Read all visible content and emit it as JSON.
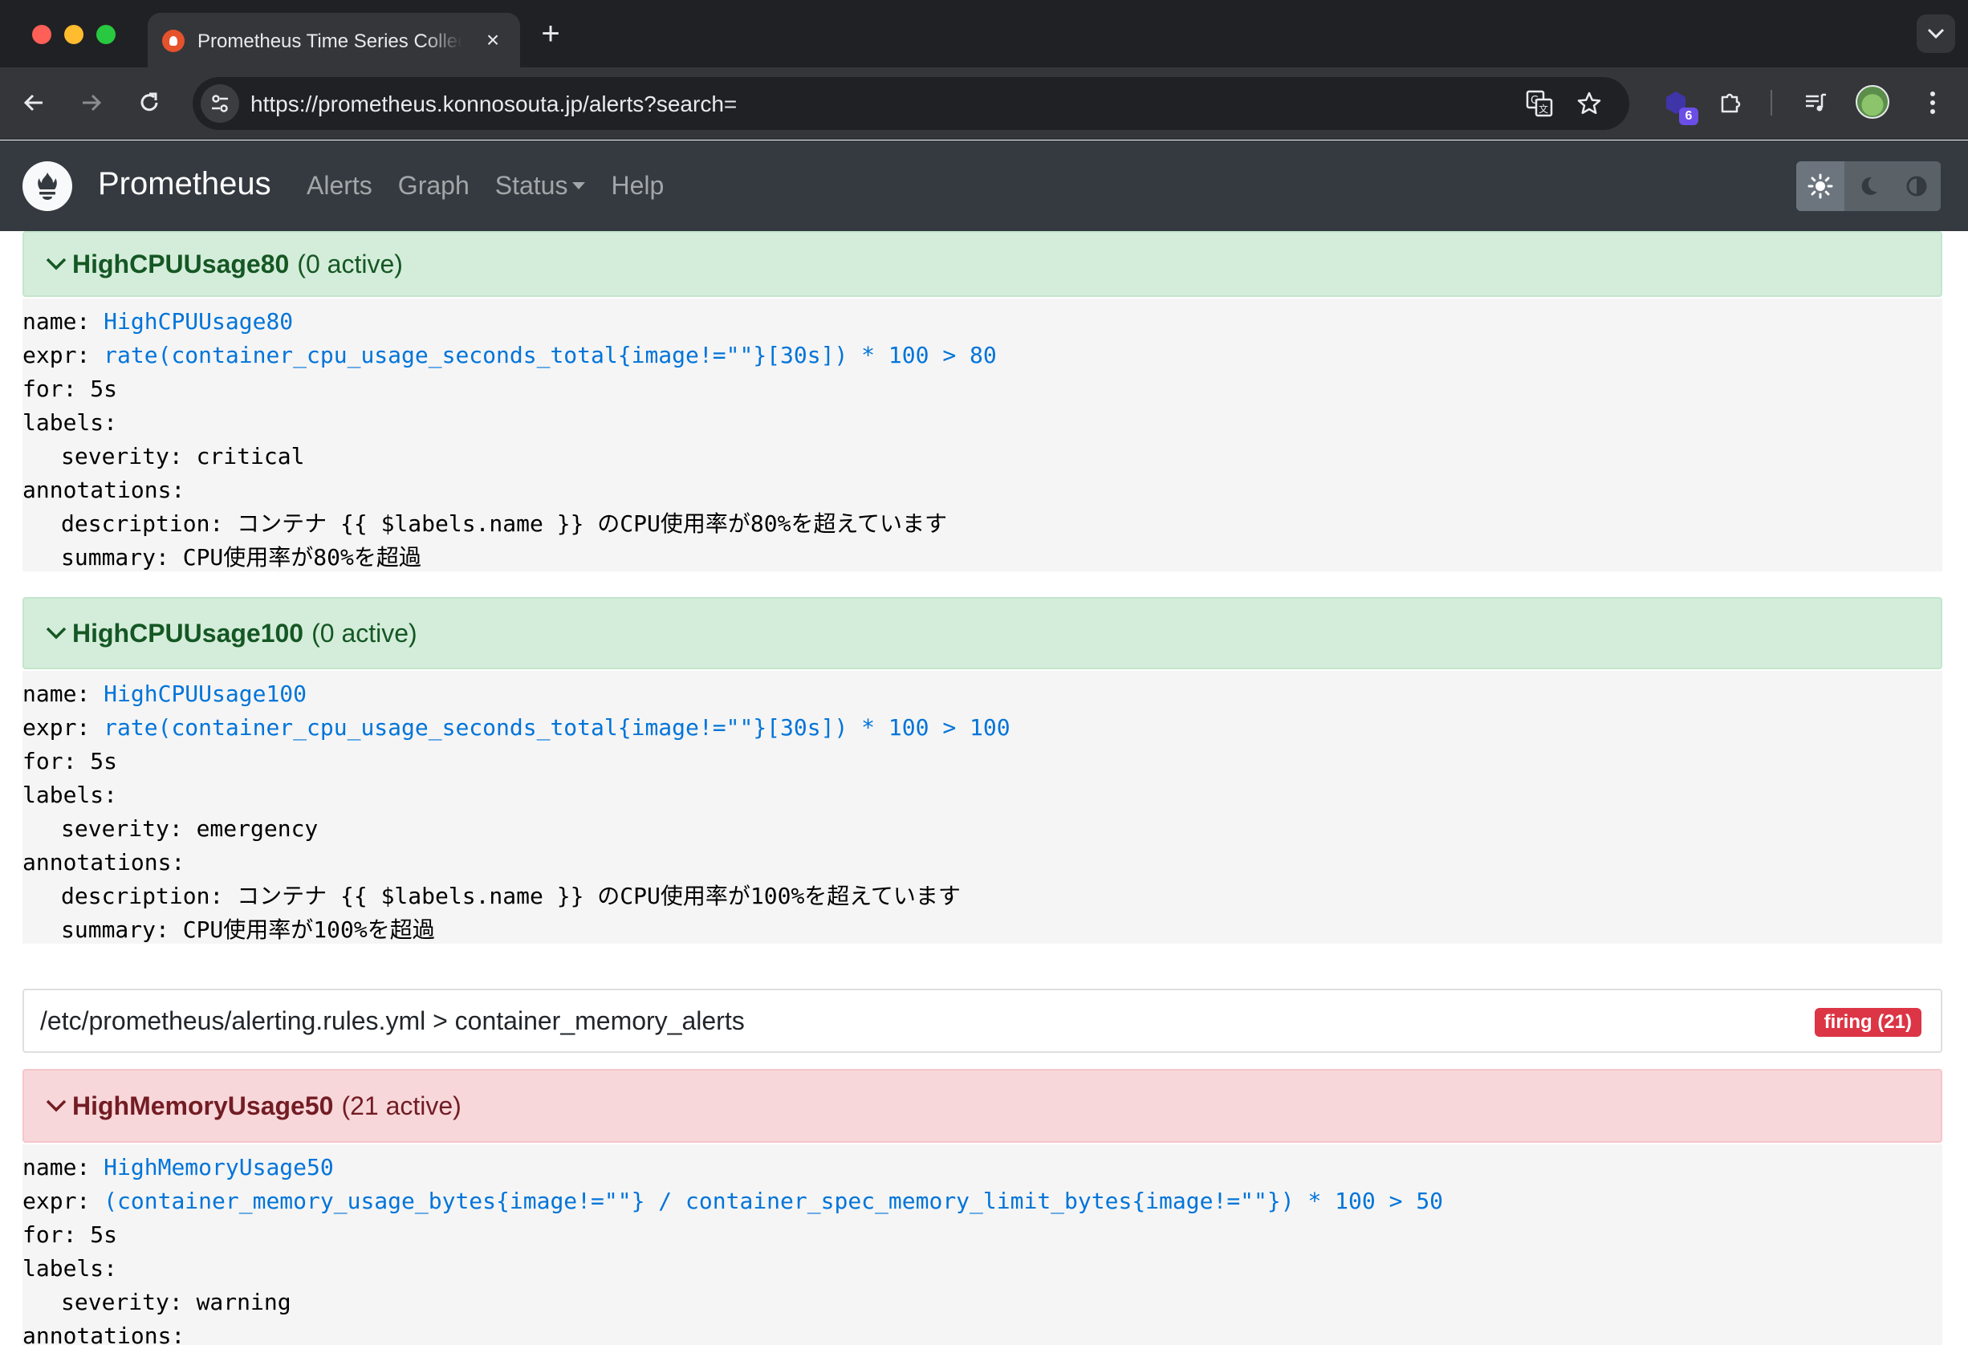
{
  "browser": {
    "tab_title": "Prometheus Time Series Collection and Processing Server",
    "url": "https://prometheus.konnosouta.jp/alerts?search=",
    "extension_badge": "6"
  },
  "app": {
    "brand": "Prometheus",
    "nav": [
      "Alerts",
      "Graph",
      "Status",
      "Help"
    ]
  },
  "rules": [
    {
      "name": "HighCPUUsage80",
      "count": "(0 active)",
      "state": "inactive",
      "lines": [
        {
          "k": "name: ",
          "v": "HighCPUUsage80"
        },
        {
          "k": "expr: ",
          "v": "rate(container_cpu_usage_seconds_total{image!=\"\"}[30s]) * 100 > 80"
        },
        {
          "k": "for: 5s",
          "v": ""
        },
        {
          "k": "labels:",
          "v": ""
        },
        {
          "k": "severity: critical",
          "v": "",
          "indent": true
        },
        {
          "k": "annotations:",
          "v": ""
        },
        {
          "k": "description: コンテナ {{ $labels.name }} のCPU使用率が80%を超えています",
          "v": "",
          "indent": true
        },
        {
          "k": "summary: CPU使用率が80%を超過",
          "v": "",
          "indent": true
        }
      ]
    },
    {
      "name": "HighCPUUsage100",
      "count": "(0 active)",
      "state": "inactive",
      "lines": [
        {
          "k": "name: ",
          "v": "HighCPUUsage100"
        },
        {
          "k": "expr: ",
          "v": "rate(container_cpu_usage_seconds_total{image!=\"\"}[30s]) * 100 > 100"
        },
        {
          "k": "for: 5s",
          "v": ""
        },
        {
          "k": "labels:",
          "v": ""
        },
        {
          "k": "severity: emergency",
          "v": "",
          "indent": true
        },
        {
          "k": "annotations:",
          "v": ""
        },
        {
          "k": "description: コンテナ {{ $labels.name }} のCPU使用率が100%を超えています",
          "v": "",
          "indent": true
        },
        {
          "k": "summary: CPU使用率が100%を超過",
          "v": "",
          "indent": true
        }
      ]
    }
  ],
  "group": {
    "title": "/etc/prometheus/alerting.rules.yml > container_memory_alerts",
    "badge": "firing (21)"
  },
  "memory_rule": {
    "name": "HighMemoryUsage50",
    "count": "(21 active)",
    "state": "firing",
    "lines": [
      {
        "k": "name: ",
        "v": "HighMemoryUsage50"
      },
      {
        "k": "expr: ",
        "v": "(container_memory_usage_bytes{image!=\"\"} / container_spec_memory_limit_bytes{image!=\"\"}) * 100 > 50"
      },
      {
        "k": "for: 5s",
        "v": ""
      },
      {
        "k": "labels:",
        "v": ""
      },
      {
        "k": "severity: warning",
        "v": "",
        "indent": true
      },
      {
        "k": "annotations:",
        "v": ""
      }
    ]
  }
}
